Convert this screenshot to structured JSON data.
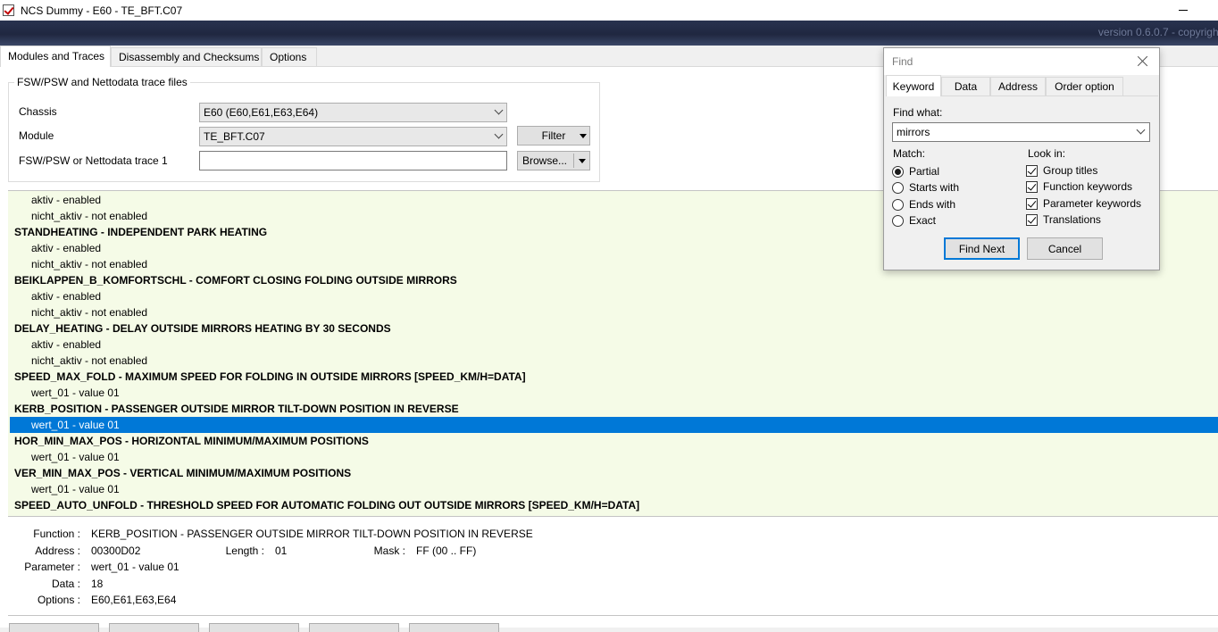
{
  "window": {
    "title": "NCS Dummy - E60 - TE_BFT.C07",
    "icon": "app-check-icon",
    "minimize_icon": "minimize-icon"
  },
  "banner": {
    "version": "version 0.6.0.7 - copyright"
  },
  "tabs": [
    {
      "label": "Modules and Traces",
      "active": true
    },
    {
      "label": "Disassembly and Checksums",
      "active": false
    },
    {
      "label": "Options",
      "active": false
    }
  ],
  "files": {
    "group_title": "FSW/PSW and Nettodata trace files",
    "chassis_label": "Chassis",
    "chassis_value": "E60  (E60,E61,E63,E64)",
    "module_label": "Module",
    "module_value": "TE_BFT.C07",
    "trace_label": "FSW/PSW or Nettodata trace 1",
    "trace_value": "",
    "filter_label": "Filter",
    "browse_label": "Browse..."
  },
  "tree_rows": [
    {
      "text": "aktiv  -  enabled",
      "type": "param",
      "selected": false
    },
    {
      "text": "nicht_aktiv  -  not enabled",
      "type": "param",
      "selected": false
    },
    {
      "text": "STANDHEATING  -  INDEPENDENT PARK HEATING",
      "type": "group",
      "selected": false
    },
    {
      "text": "aktiv  -  enabled",
      "type": "param",
      "selected": false
    },
    {
      "text": "nicht_aktiv  -  not enabled",
      "type": "param",
      "selected": false
    },
    {
      "text": "BEIKLAPPEN_B_KOMFORTSCHL  -  COMFORT CLOSING FOLDING OUTSIDE MIRRORS",
      "type": "group",
      "selected": false
    },
    {
      "text": "aktiv  -  enabled",
      "type": "param",
      "selected": false
    },
    {
      "text": "nicht_aktiv  -  not enabled",
      "type": "param",
      "selected": false
    },
    {
      "text": "DELAY_HEATING  -  DELAY OUTSIDE MIRRORS HEATING BY 30 SECONDS",
      "type": "group",
      "selected": false
    },
    {
      "text": "aktiv  -  enabled",
      "type": "param",
      "selected": false
    },
    {
      "text": "nicht_aktiv  -  not enabled",
      "type": "param",
      "selected": false
    },
    {
      "text": "SPEED_MAX_FOLD  -  MAXIMUM SPEED FOR FOLDING IN OUTSIDE MIRRORS [SPEED_KM/H=DATA]",
      "type": "group",
      "selected": false
    },
    {
      "text": "wert_01  -  value 01",
      "type": "param",
      "selected": false
    },
    {
      "text": "KERB_POSITION  -  PASSENGER OUTSIDE MIRROR TILT-DOWN POSITION IN REVERSE",
      "type": "group",
      "selected": false
    },
    {
      "text": "wert_01  -  value 01",
      "type": "param",
      "selected": true
    },
    {
      "text": "HOR_MIN_MAX_POS  -  HORIZONTAL MINIMUM/MAXIMUM POSITIONS",
      "type": "group",
      "selected": false
    },
    {
      "text": "wert_01  -  value 01",
      "type": "param",
      "selected": false
    },
    {
      "text": "VER_MIN_MAX_POS  -  VERTICAL MINIMUM/MAXIMUM POSITIONS",
      "type": "group",
      "selected": false
    },
    {
      "text": "wert_01  -  value 01",
      "type": "param",
      "selected": false
    },
    {
      "text": "SPEED_AUTO_UNFOLD  -  THRESHOLD SPEED FOR AUTOMATIC FOLDING OUT OUTSIDE MIRRORS [SPEED_KM/H=DATA]",
      "type": "group",
      "selected": false
    }
  ],
  "details": {
    "function_label": "Function :",
    "function_value": "KERB_POSITION  -  PASSENGER OUTSIDE MIRROR TILT-DOWN POSITION IN REVERSE",
    "address_label": "Address :",
    "address_value": "00300D02",
    "length_label": "Length :",
    "length_value": "01",
    "mask_label": "Mask :",
    "mask_value": "FF  (00 .. FF)",
    "parameter_label": "Parameter :",
    "parameter_value": "wert_01  -  value 01",
    "data_label": "Data :",
    "data_value": "18",
    "options_label": "Options :",
    "options_value": "E60,E61,E63,E64"
  },
  "find_dialog": {
    "title": "Find",
    "close_icon": "close-icon",
    "tabs": [
      {
        "label": "Keyword",
        "active": true
      },
      {
        "label": "Data",
        "active": false
      },
      {
        "label": "Address",
        "active": false
      },
      {
        "label": "Order option",
        "active": false
      }
    ],
    "find_what_label": "Find what:",
    "find_what_value": "mirrors",
    "match_label": "Match:",
    "match_options": [
      {
        "label": "Partial",
        "checked": true
      },
      {
        "label": "Starts with",
        "checked": false
      },
      {
        "label": "Ends with",
        "checked": false
      },
      {
        "label": "Exact",
        "checked": false
      }
    ],
    "look_in_label": "Look in:",
    "look_in_options": [
      {
        "label": "Group titles",
        "checked": true
      },
      {
        "label": "Function keywords",
        "checked": true
      },
      {
        "label": "Parameter keywords",
        "checked": true
      },
      {
        "label": "Translations",
        "checked": true
      }
    ],
    "find_next_label": "Find Next",
    "cancel_label": "Cancel"
  },
  "colors": {
    "banner": "#1f2740",
    "selection": "#0078d7",
    "tree_background": "#f5fbe7"
  }
}
